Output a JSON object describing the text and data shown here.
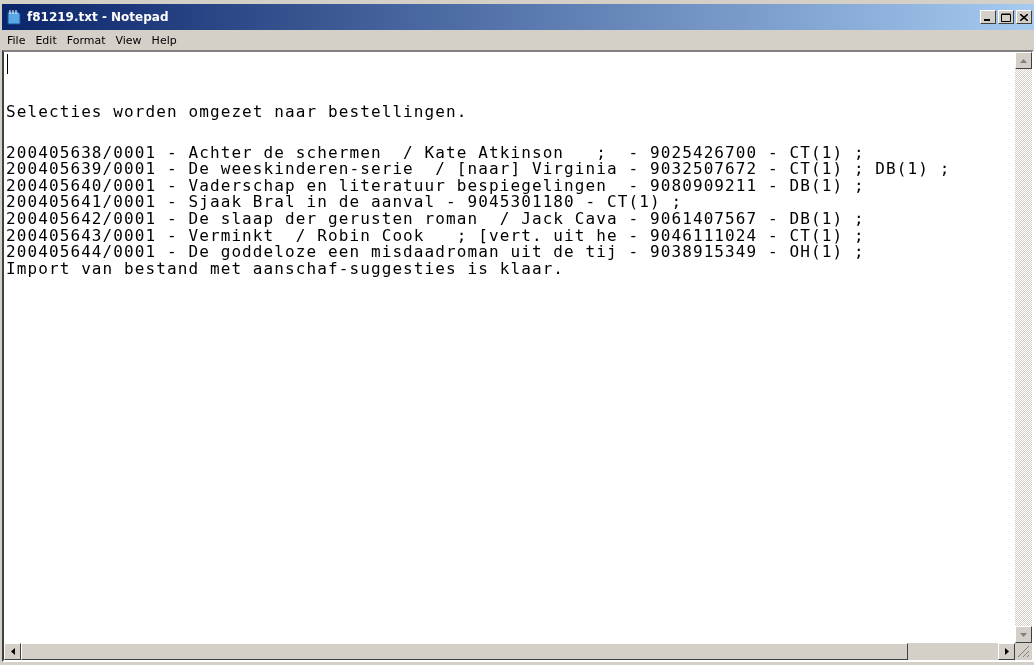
{
  "window": {
    "title": "f81219.txt - Notepad"
  },
  "menu": [
    {
      "label": "File"
    },
    {
      "label": "Edit"
    },
    {
      "label": "Format"
    },
    {
      "label": "View"
    },
    {
      "label": "Help"
    }
  ],
  "document": {
    "intro": "Selecties worden omgezet naar bestellingen.",
    "lines": [
      "200405638/0001 - Achter de schermen  / Kate Atkinson   ;  - 9025426700 - CT(1) ;",
      "200405639/0001 - De weeskinderen-serie  / [naar] Virginia - 9032507672 - CT(1) ; DB(1) ;",
      "200405640/0001 - Vaderschap en literatuur bespiegelingen  - 9080909211 - DB(1) ;",
      "200405641/0001 - Sjaak Bral in de aanval - 9045301180 - CT(1) ;",
      "200405642/0001 - De slaap der gerusten roman  / Jack Cava - 9061407567 - DB(1) ;",
      "200405643/0001 - Verminkt  / Robin Cook   ; [vert. uit he - 9046111024 - CT(1) ;",
      "200405644/0001 - De goddeloze een misdaadroman uit de tij - 9038915349 - OH(1) ;"
    ],
    "outro": "Import van bestand met aanschaf-suggesties is klaar."
  }
}
